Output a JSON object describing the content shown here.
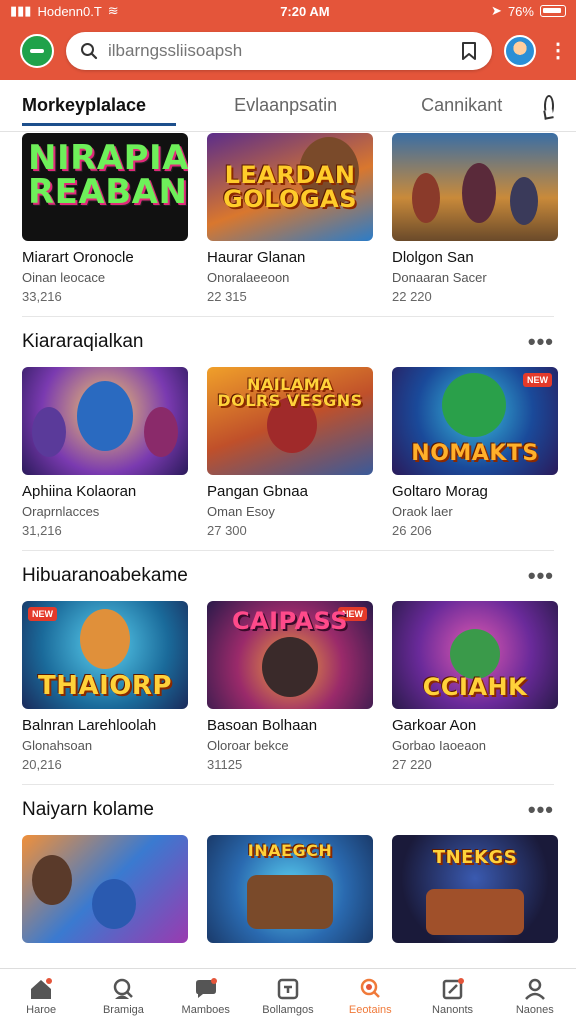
{
  "status": {
    "left": "Hodenn0.T",
    "time": "7:20 AM",
    "right": "76%"
  },
  "search": {
    "placeholder": "ilbarngssliisoapsh"
  },
  "tabs": [
    {
      "label": "Morkeyplalace"
    },
    {
      "label": "Evlaanpsatin"
    },
    {
      "label": "Cannikant"
    }
  ],
  "sections": [
    {
      "title": "",
      "cards": [
        {
          "name": "Miarart Oronocle",
          "sub": "Oinan leocace",
          "count": "33,216",
          "art": "NIRAPIAN REABAN"
        },
        {
          "name": "Haurar Glanan",
          "sub": "Onoralaeeoon",
          "count": "22 315",
          "art": "LEARDAN GOLOGAS"
        },
        {
          "name": "Dlolgon San",
          "sub": "Donaaran Sacer",
          "count": "22 220",
          "art": ""
        }
      ]
    },
    {
      "title": "Kiararaqialkan",
      "cards": [
        {
          "name": "Aphiina Kolaoran",
          "sub": "Oraprnlacces",
          "count": "31,216",
          "art": ""
        },
        {
          "name": "Pangan Gbnaa",
          "sub": "Oman Esoy",
          "count": "27 300",
          "art": "NAILAMA DOLRS VESGNS"
        },
        {
          "name": "Goltaro Morag",
          "sub": "Oraok laer",
          "count": "26 206",
          "art": "NOMAKTS"
        }
      ]
    },
    {
      "title": "Hibuaranoabekame",
      "cards": [
        {
          "name": "Balnran Larehloolah",
          "sub": "Glonahsoan",
          "count": "20,216",
          "art": "THAIORP"
        },
        {
          "name": "Basoan Bolhaan",
          "sub": "Oloroar bekce",
          "count": "31125",
          "art": "CAIPASS"
        },
        {
          "name": "Garkoar Aon",
          "sub": "Gorbao Iaoeaon",
          "count": "27 220",
          "art": "CCIAHK"
        }
      ]
    },
    {
      "title": "Naiyarn kolame",
      "cards": [
        {
          "name": "",
          "sub": "",
          "count": "",
          "art": ""
        },
        {
          "name": "",
          "sub": "",
          "count": "",
          "art": "INAEGCH"
        },
        {
          "name": "",
          "sub": "",
          "count": "",
          "art": "TNEKGS"
        }
      ]
    }
  ],
  "nav": [
    {
      "label": "Haroe",
      "icon": "home-icon"
    },
    {
      "label": "Bramiga",
      "icon": "search-person-icon"
    },
    {
      "label": "Mamboes",
      "icon": "chat-bubble-icon"
    },
    {
      "label": "Bollamgos",
      "icon": "box-icon"
    },
    {
      "label": "Eeotains",
      "icon": "search-icon"
    },
    {
      "label": "Nanonts",
      "icon": "edit-icon"
    },
    {
      "label": "Naones",
      "icon": "person-icon"
    }
  ],
  "colors": {
    "header": "#e4553a",
    "accent": "#1d4f8c",
    "active_nav": "#f07a3a"
  }
}
